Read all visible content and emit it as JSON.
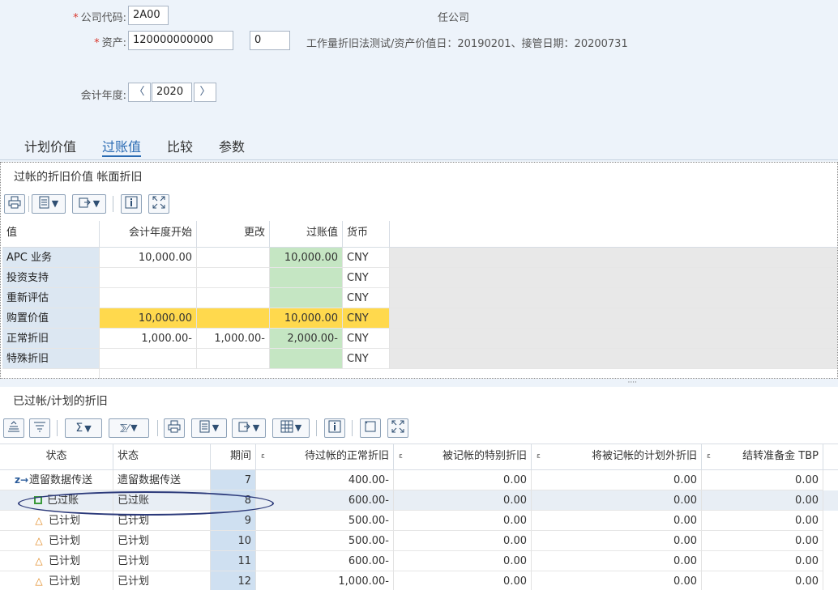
{
  "header": {
    "company_code_label": "公司代码:",
    "company_code_value": "2A00",
    "company_name_visible": "任公司",
    "asset_label": "资产:",
    "asset_value": "120000000000",
    "asset_sub_value": "0",
    "asset_description": "工作量折旧法测试/资产价值日：20190201、接管日期：20200731",
    "fiscal_year_label": "会计年度:",
    "fiscal_year_value": "2020",
    "prev_glyph": "〈",
    "next_glyph": "〉"
  },
  "tabs": [
    {
      "label": "计划价值",
      "active": false
    },
    {
      "label": "过账值",
      "active": true
    },
    {
      "label": "比较",
      "active": false
    },
    {
      "label": "参数",
      "active": false
    }
  ],
  "panel1": {
    "title": "过帐的折旧价值 帐面折旧",
    "columns": [
      "值",
      "会计年度开始",
      "更改",
      "过账值",
      "货币"
    ],
    "rows": [
      {
        "label": "APC 业务",
        "start": "10,000.00",
        "change": "",
        "posted": "10,000.00",
        "currency": "CNY",
        "highlight": false
      },
      {
        "label": "投资支持",
        "start": "",
        "change": "",
        "posted": "",
        "currency": "CNY",
        "highlight": false
      },
      {
        "label": "重新评估",
        "start": "",
        "change": "",
        "posted": "",
        "currency": "CNY",
        "highlight": false
      },
      {
        "label": "购置价值",
        "start": "10,000.00",
        "change": "",
        "posted": "10,000.00",
        "currency": "CNY",
        "highlight": true
      },
      {
        "label": "正常折旧",
        "start": "1,000.00-",
        "change": "1,000.00-",
        "posted": "2,000.00-",
        "currency": "CNY",
        "highlight": false
      },
      {
        "label": "特殊折旧",
        "start": "",
        "change": "",
        "posted": "",
        "currency": "CNY",
        "highlight": false
      }
    ]
  },
  "panel2": {
    "title": "已过帐/计划的折旧",
    "sort_marker": "ε",
    "columns": [
      "状态",
      "状态",
      "期间",
      "待过帐的正常折旧",
      "被记帐的特别折旧",
      "将被记帐的计划外折旧",
      "结转准备金 TBP"
    ],
    "rows": [
      {
        "icon": "transfer-icon",
        "status_icon_text": "遗留数据传送",
        "status": "遗留数据传送",
        "period": "7",
        "normal": "400.00-",
        "special": "0.00",
        "unplanned": "0.00",
        "reserve": "0.00"
      },
      {
        "icon": "posted-square-icon",
        "status_icon_text": "已过账",
        "status": "已过账",
        "period": "8",
        "normal": "600.00-",
        "special": "0.00",
        "unplanned": "0.00",
        "reserve": "0.00"
      },
      {
        "icon": "planned-triangle-icon",
        "status_icon_text": "已计划",
        "status": "已计划",
        "period": "9",
        "normal": "500.00-",
        "special": "0.00",
        "unplanned": "0.00",
        "reserve": "0.00"
      },
      {
        "icon": "planned-triangle-icon",
        "status_icon_text": "已计划",
        "status": "已计划",
        "period": "10",
        "normal": "500.00-",
        "special": "0.00",
        "unplanned": "0.00",
        "reserve": "0.00"
      },
      {
        "icon": "planned-triangle-icon",
        "status_icon_text": "已计划",
        "status": "已计划",
        "period": "11",
        "normal": "600.00-",
        "special": "0.00",
        "unplanned": "0.00",
        "reserve": "0.00"
      },
      {
        "icon": "planned-triangle-icon",
        "status_icon_text": "已计划",
        "status": "已计划",
        "period": "12",
        "normal": "1,000.00-",
        "special": "0.00",
        "unplanned": "0.00",
        "reserve": "0.00"
      }
    ]
  },
  "colors": {
    "accent": "#2a6bb3",
    "posted_column": "#c5e6c3",
    "highlight_row": "#ffd94d",
    "row_header": "#dce7f2"
  }
}
